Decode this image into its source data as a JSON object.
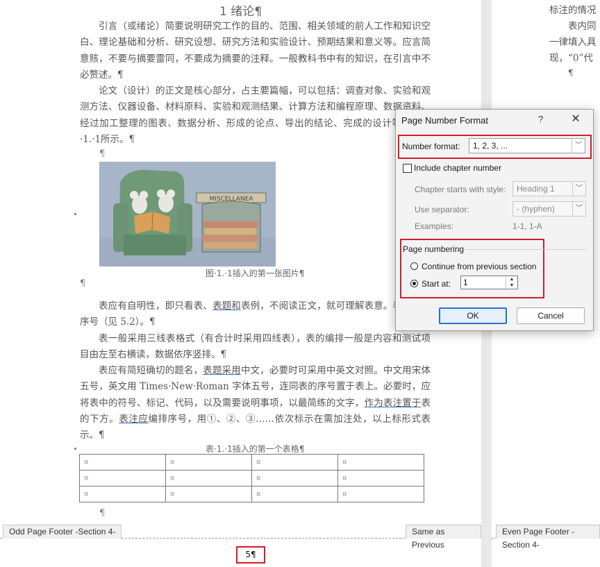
{
  "document": {
    "heading": "1 绪论¶",
    "para1": "引言（或绪论）简要说明研究工作的目的、范围、相关领域的前人工作和知识空白、理论基础和分析、研究设想、研究方法和实验设计、预期结果和意义等。应言简意赅，不要与摘要雷同，不要成为摘要的注释。一般教科书中有的知识，在引言中不必赘述。¶",
    "para2": "论文（设计）的正文是核心部分，占主要篇幅，可以包括：调查对象、实验和观测方法、仪器设备、材料原料、实验和观测结果、计算方法和编程原理、数据资料、经过加工整理的图表、数据分析、形成的论点、导出的结论、完成的设计等。如图·1.·1所示。¶",
    "pilcrow": "¶",
    "figure_caption": "图·1.·1插入的第一张图片¶",
    "figure_sign": "MISCELLANEA",
    "para3_a": "表应有自明性，即只看表、",
    "para3_u1": "表题和",
    "para3_b": "表例，不阅读正文，就可理解表意。表应编排序号（见 5.2）。¶",
    "para4": "表一般采用三线表格式（有合计时采用四线表），表的编排一般是内容和测试项目由左至右横读，数据依序竖排。¶",
    "para5_a": "表应有简短确切的题名，",
    "para5_u1": "表题采用",
    "para5_b": "中文，必要时可采用中英文对照。中文用宋体五号，英文用 Times·New·Roman 字体五号，连同表的序号置于表上。必要时，应将表中的符号、标记、代码，以及需要说明事项，以最简练的文字，",
    "para5_u2": "作为表注置于",
    "para5_c": "表的下方。",
    "para5_u3": "表注应",
    "para5_d": "编排序号，用①、②、③……依次标示在需加注处，以上标形式表示。¶",
    "table_caption": "表·1.·1插入的第一个表格¶",
    "table_cell": "¤",
    "table_rows": 3,
    "table_cols": 4,
    "odd_footer_label": "Odd Page Footer -Section 4-",
    "same_as_previous_label": "Same as Previous",
    "page_number": "5¶",
    "right_line1": "标注的情况",
    "right_line2": "表内同",
    "right_line3": "一律填入具",
    "right_line4": "现，“0”代",
    "right_pilcrow": "¶",
    "even_footer_label": "Even Page Footer -Section 4-"
  },
  "dialog": {
    "title": "Page Number Format",
    "help": "?",
    "close": "✕",
    "number_format_label": "Number format:",
    "number_format_value": "1, 2, 3, ...",
    "include_chapter_label": "Include chapter number",
    "include_chapter_checked": false,
    "chapter_style_label": "Chapter starts with style:",
    "chapter_style_value": "Heading 1",
    "separator_label": "Use separator:",
    "separator_value": "-   (hyphen)",
    "examples_label": "Examples:",
    "examples_value": "1-1, 1-A",
    "page_numbering_label": "Page numbering",
    "continue_label": "Continue from previous section",
    "start_at_label": "Start at:",
    "start_at_value": "1",
    "selected_option": "start_at",
    "ok_label": "OK",
    "cancel_label": "Cancel",
    "highlight_color": "#d01f2b",
    "accent_color": "#2b6fd6"
  }
}
